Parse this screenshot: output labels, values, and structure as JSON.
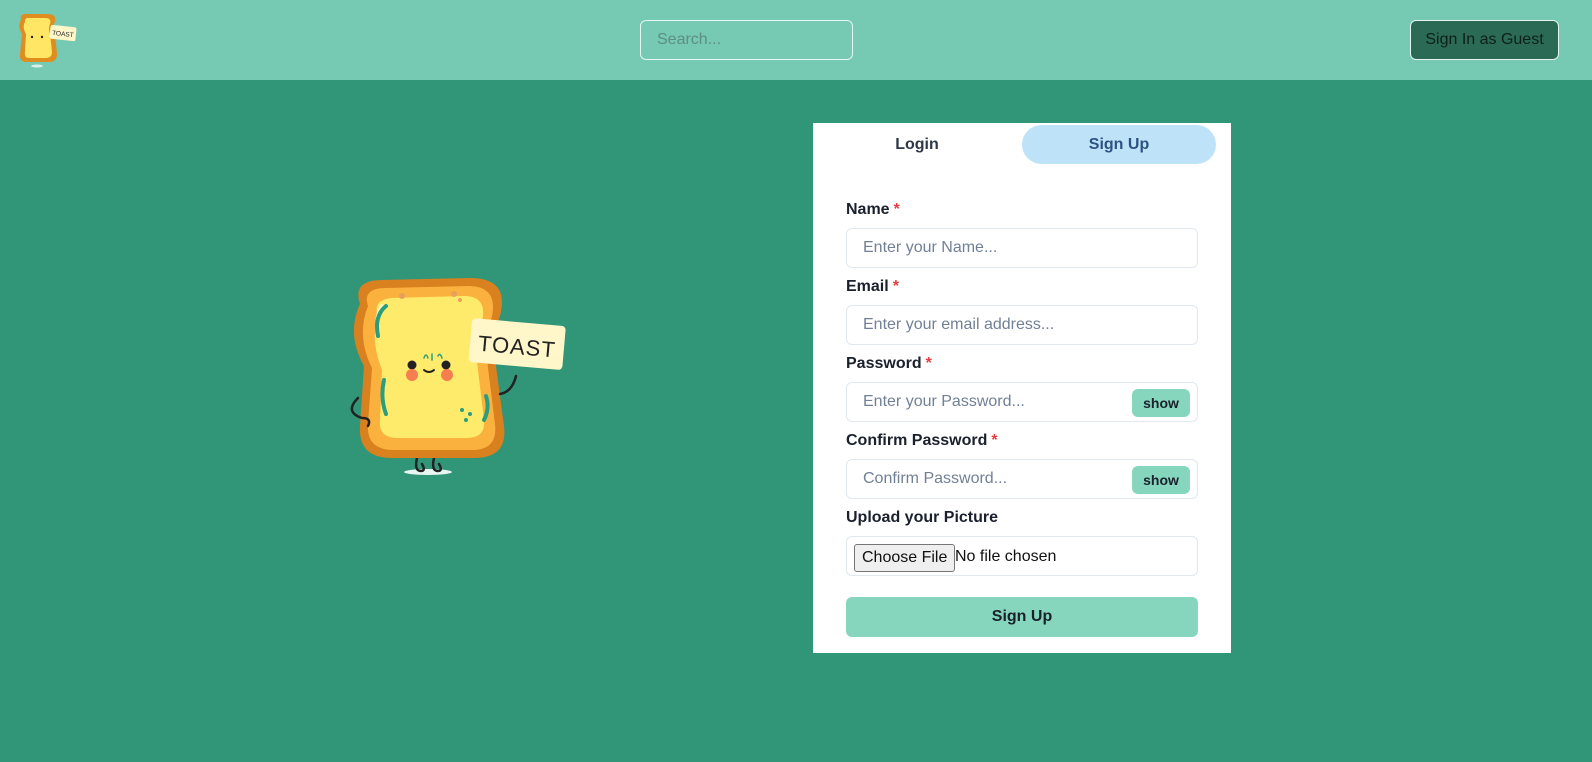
{
  "header": {
    "logo_text": "TOAST",
    "search_placeholder": "Search...",
    "guest_button": "Sign In as Guest"
  },
  "mascot": {
    "sign_text": "TOAST"
  },
  "auth": {
    "tabs": [
      {
        "label": "Login",
        "active": false
      },
      {
        "label": "Sign Up",
        "active": true
      }
    ],
    "fields": {
      "name": {
        "label": "Name",
        "required_mark": "*",
        "placeholder": "Enter your Name..."
      },
      "email": {
        "label": "Email",
        "required_mark": "*",
        "placeholder": "Enter your email address..."
      },
      "password": {
        "label": "Password",
        "required_mark": "*",
        "placeholder": "Enter your Password...",
        "toggle": "show"
      },
      "confirm_password": {
        "label": "Confirm Password",
        "required_mark": "*",
        "placeholder": "Confirm Password...",
        "toggle": "show"
      },
      "picture": {
        "label": "Upload your Picture",
        "button": "Choose File",
        "status": "No file chosen"
      }
    },
    "submit_label": "Sign Up"
  },
  "colors": {
    "page_bg": "#319578",
    "topbar_bg": "#76c9b2",
    "guest_button_bg": "#2b6b55",
    "active_tab_bg": "#bee3f8",
    "accent_button_bg": "#86d6bd",
    "required_mark": "#e53e3e"
  },
  "icons": {
    "logo": "toast-logo-icon",
    "mascot": "toast-mascot-illustration"
  }
}
